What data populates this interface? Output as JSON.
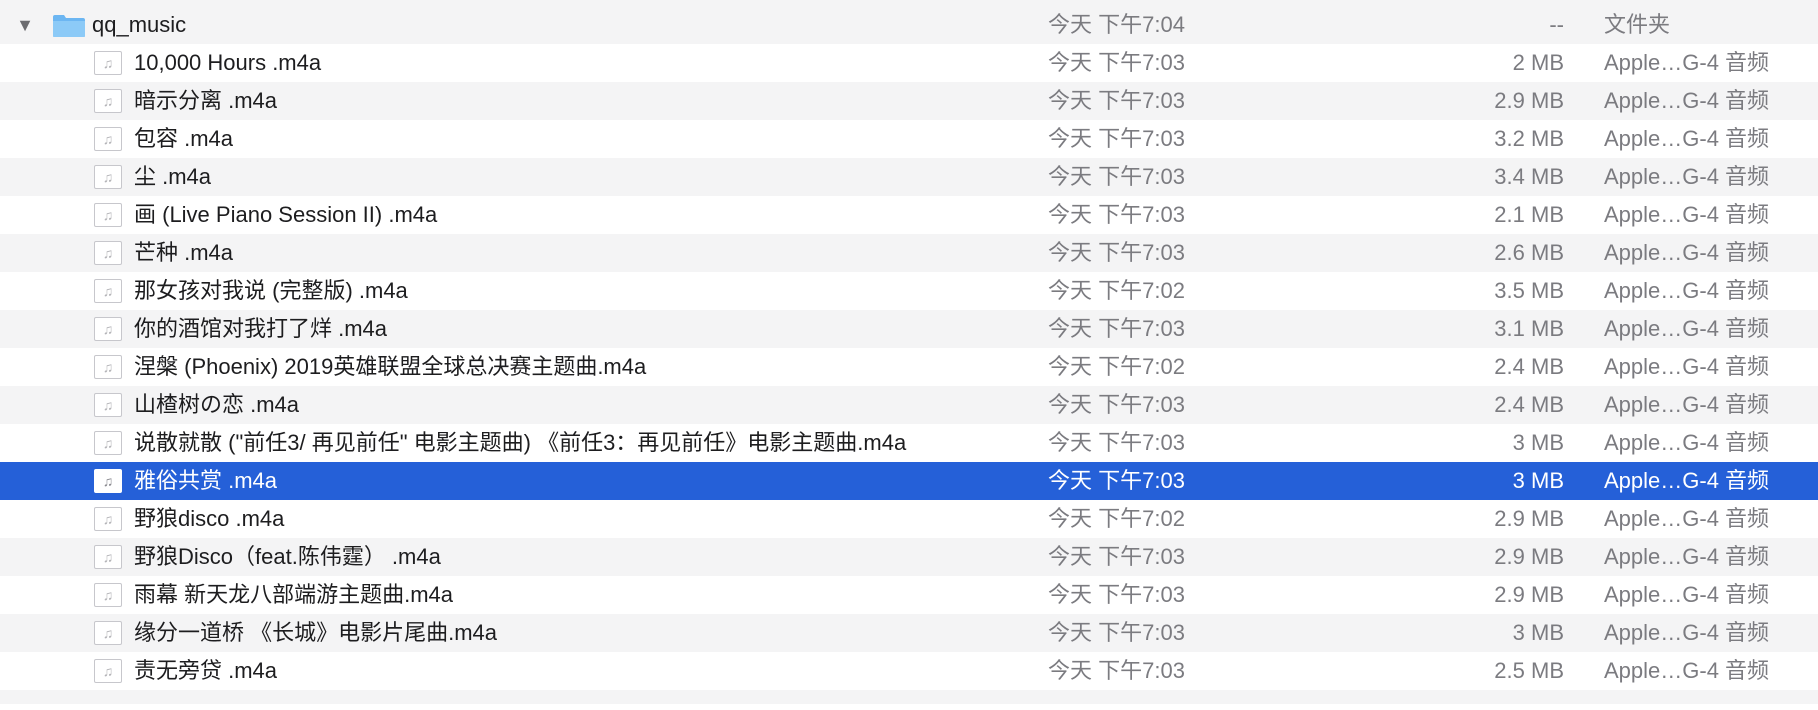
{
  "folder": {
    "disclosure_icon": "disclosure-triangle-down-icon",
    "icon": "folder-icon",
    "name": "qq_music",
    "date": "今天 下午7:04",
    "size": "--",
    "kind": "文件夹"
  },
  "files": [
    {
      "name": "10,000 Hours .m4a",
      "date": "今天 下午7:03",
      "size": "2 MB",
      "kind": "Apple…G-4 音频"
    },
    {
      "name": "暗示分离 .m4a",
      "date": "今天 下午7:03",
      "size": "2.9 MB",
      "kind": "Apple…G-4 音频"
    },
    {
      "name": "包容 .m4a",
      "date": "今天 下午7:03",
      "size": "3.2 MB",
      "kind": "Apple…G-4 音频"
    },
    {
      "name": "尘 .m4a",
      "date": "今天 下午7:03",
      "size": "3.4 MB",
      "kind": "Apple…G-4 音频"
    },
    {
      "name": "画 (Live Piano Session II) .m4a",
      "date": "今天 下午7:03",
      "size": "2.1 MB",
      "kind": "Apple…G-4 音频"
    },
    {
      "name": "芒种 .m4a",
      "date": "今天 下午7:03",
      "size": "2.6 MB",
      "kind": "Apple…G-4 音频"
    },
    {
      "name": "那女孩对我说 (完整版) .m4a",
      "date": "今天 下午7:02",
      "size": "3.5 MB",
      "kind": "Apple…G-4 音频"
    },
    {
      "name": "你的酒馆对我打了烊 .m4a",
      "date": "今天 下午7:03",
      "size": "3.1 MB",
      "kind": "Apple…G-4 音频"
    },
    {
      "name": "涅槃 (Phoenix) 2019英雄联盟全球总决赛主题曲.m4a",
      "date": "今天 下午7:02",
      "size": "2.4 MB",
      "kind": "Apple…G-4 音频"
    },
    {
      "name": "山楂树の恋 .m4a",
      "date": "今天 下午7:03",
      "size": "2.4 MB",
      "kind": "Apple…G-4 音频"
    },
    {
      "name": "说散就散 (\"前任3/ 再见前任\" 电影主题曲) 《前任3：再见前任》电影主题曲.m4a",
      "date": "今天 下午7:03",
      "size": "3 MB",
      "kind": "Apple…G-4 音频"
    },
    {
      "name": "雅俗共赏 .m4a",
      "date": "今天 下午7:03",
      "size": "3 MB",
      "kind": "Apple…G-4 音频",
      "selected": true
    },
    {
      "name": "野狼disco .m4a",
      "date": "今天 下午7:02",
      "size": "2.9 MB",
      "kind": "Apple…G-4 音频"
    },
    {
      "name": "野狼Disco（feat.陈伟霆） .m4a",
      "date": "今天 下午7:03",
      "size": "2.9 MB",
      "kind": "Apple…G-4 音频"
    },
    {
      "name": "雨幕 新天龙八部端游主题曲.m4a",
      "date": "今天 下午7:03",
      "size": "2.9 MB",
      "kind": "Apple…G-4 音频"
    },
    {
      "name": "缘分一道桥 《长城》电影片尾曲.m4a",
      "date": "今天 下午7:03",
      "size": "3 MB",
      "kind": "Apple…G-4 音频"
    },
    {
      "name": "责无旁贷 .m4a",
      "date": "今天 下午7:03",
      "size": "2.5 MB",
      "kind": "Apple…G-4 音频"
    }
  ],
  "file_icon": "audio-file-icon",
  "colors": {
    "selection": "#2560d8",
    "alt_row": "#f4f4f5",
    "secondary_text": "#7b7b80",
    "folder_blue": "#6cb6f2"
  }
}
